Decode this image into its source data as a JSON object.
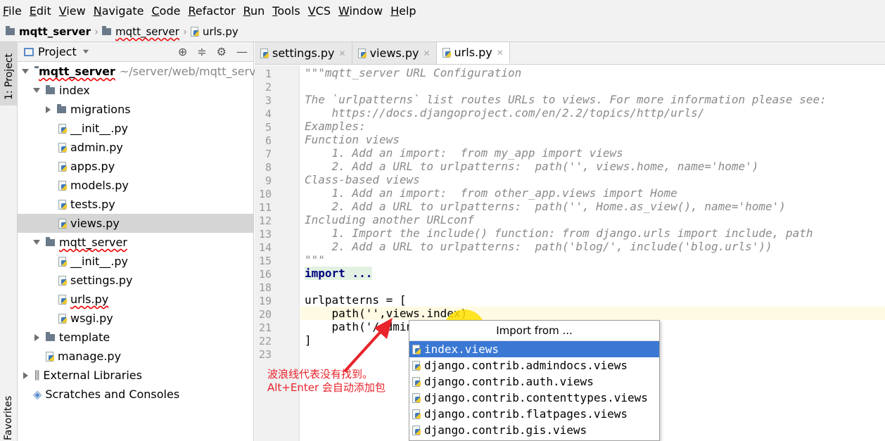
{
  "menu": [
    "File",
    "Edit",
    "View",
    "Navigate",
    "Code",
    "Refactor",
    "Run",
    "Tools",
    "VCS",
    "Window",
    "Help"
  ],
  "breadcrumb": [
    "mqtt_server",
    "mqtt_server",
    "urls.py"
  ],
  "left_toolbar": {
    "project_tab": "1: Project",
    "favorites_tab": "Favorites"
  },
  "project": {
    "title": "Project",
    "root": {
      "name": "mqtt_server",
      "path": "~/server/web/mqtt_server"
    },
    "items": [
      {
        "label": "index"
      },
      {
        "label": "migrations"
      },
      {
        "label": "__init__.py"
      },
      {
        "label": "admin.py"
      },
      {
        "label": "apps.py"
      },
      {
        "label": "models.py"
      },
      {
        "label": "tests.py"
      },
      {
        "label": "views.py"
      },
      {
        "label": "mqtt_server"
      },
      {
        "label": "__init__.py"
      },
      {
        "label": "settings.py"
      },
      {
        "label": "urls.py"
      },
      {
        "label": "wsgi.py"
      },
      {
        "label": "template"
      },
      {
        "label": "manage.py"
      },
      {
        "label": "External Libraries"
      },
      {
        "label": "Scratches and Consoles"
      }
    ]
  },
  "tabs": [
    {
      "label": "settings.py"
    },
    {
      "label": "views.py"
    },
    {
      "label": "urls.py"
    }
  ],
  "lines": [
    "\"\"\"mqtt_server URL Configuration",
    "",
    "The `urlpatterns` list routes URLs to views. For more information please see:",
    "    https://docs.djangoproject.com/en/2.2/topics/http/urls/",
    "Examples:",
    "Function views",
    "    1. Add an import:  from my_app import views",
    "    2. Add a URL to urlpatterns:  path('', views.home, name='home')",
    "Class-based views",
    "    1. Add an import:  from other_app.views import Home",
    "    2. Add a URL to urlpatterns:  path('', Home.as_view(), name='home')",
    "Including another URLconf",
    "    1. Import the include() function: from django.urls import include, path",
    "    2. Add a URL to urlpatterns:  path('blog/', include('blog.urls'))",
    "\"\"\"",
    "import ...",
    "",
    "urlpatterns = [",
    "    path('',views.index)",
    "    path('/admin",
    "]",
    ""
  ],
  "line_numbers": [
    "1",
    "2",
    "3",
    "4",
    "5",
    "6",
    "7",
    "8",
    "9",
    "10",
    "11",
    "12",
    "13",
    "14",
    "15",
    "16",
    "18",
    "19",
    "20",
    "21",
    "22",
    "23"
  ],
  "popup": {
    "title": "Import from ...",
    "items": [
      "index.views",
      "django.contrib.admindocs.views",
      "django.contrib.auth.views",
      "django.contrib.contenttypes.views",
      "django.contrib.flatpages.views",
      "django.contrib.gis.views"
    ]
  },
  "annotation": {
    "line1": "波浪线代表没有找到。",
    "line2": "Alt+Enter 会自动添加包"
  }
}
